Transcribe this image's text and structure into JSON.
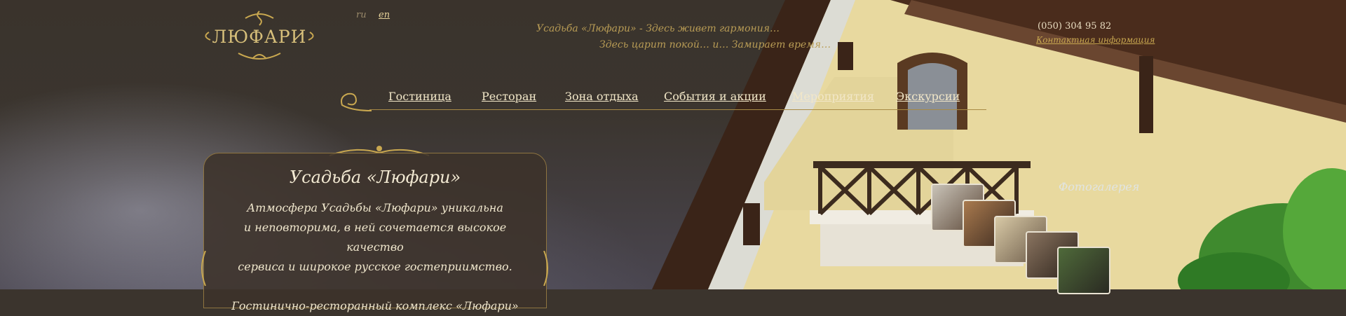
{
  "header": {
    "logo_text": "ЛЮФАРИ",
    "languages": [
      "ru",
      "en"
    ],
    "slogan_line1": "Усадьба «Люфари» - Здесь живет гармония…",
    "slogan_line2": "Здесь царит покой… и… Замирает время…",
    "phone": "(050) 304 95 82",
    "contacts_link": "Контактная информация"
  },
  "nav": {
    "items": [
      "Гостиница",
      "Ресторан",
      "Зона отдыха",
      "События и акции",
      "Мероприятия",
      "Экскурсии"
    ]
  },
  "intro": {
    "title": "Усадьба «Люфари»",
    "text_line1": "Атмосфера Усадьбы «Люфари» уникальна",
    "text_line2": "и неповторима, в ней сочетается высокое качество",
    "text_line3": "сервиса и широкое русское гостеприимство.",
    "text_line4": "Гостинично-ресторанный комплекс «Люфари»"
  },
  "gallery": {
    "label": "Фотогалерея",
    "thumbnail_count": 5
  },
  "colors": {
    "gold": "#c9a850",
    "dark_brown": "#3b342d",
    "cream": "#f2e7c8"
  }
}
